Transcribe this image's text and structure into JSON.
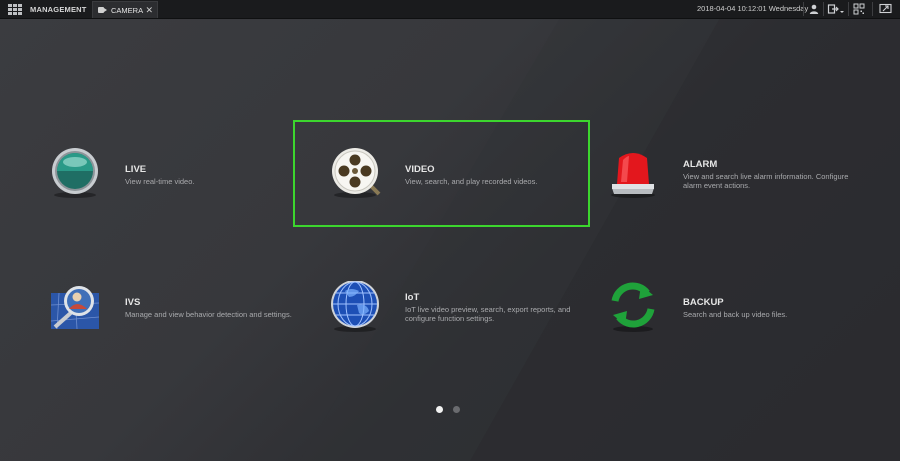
{
  "topbar": {
    "management_label": "MANAGEMENT",
    "tab_label": "CAMERA",
    "tab_close": "✕",
    "datetime": "2018-04-04 10:12:01 Wednesday",
    "icons": [
      "grid-menu-icon",
      "camera-icon",
      "user-icon",
      "logout-icon",
      "qr-code-icon",
      "fullscreen-icon"
    ]
  },
  "menu": [
    {
      "id": "live",
      "title": "LIVE",
      "desc": [
        "View real-time video."
      ],
      "icon": "live-icon"
    },
    {
      "id": "video",
      "title": "VIDEO",
      "desc": [
        "View, search, and play recorded videos."
      ],
      "icon": "video-reel-icon",
      "selected": true
    },
    {
      "id": "alarm",
      "title": "ALARM",
      "desc": [
        "View and search live alarm information. Configure",
        "alarm event actions."
      ],
      "icon": "alarm-light-icon"
    },
    {
      "id": "ivs",
      "title": "IVS",
      "desc": [
        "Manage and view behavior detection and settings."
      ],
      "icon": "ivs-magnifier-icon"
    },
    {
      "id": "iot",
      "title": "IoT",
      "desc": [
        "IoT live video preview, search, export reports, and",
        "configure function settings."
      ],
      "icon": "globe-icon"
    },
    {
      "id": "backup",
      "title": "BACKUP",
      "desc": [
        "Search and back up video files."
      ],
      "icon": "backup-refresh-icon"
    }
  ],
  "pagination": {
    "pages": 2,
    "current": 1
  },
  "colors": {
    "highlight": "#3cd62e",
    "background": "#36373b",
    "topbar": "#1a1b1d"
  }
}
